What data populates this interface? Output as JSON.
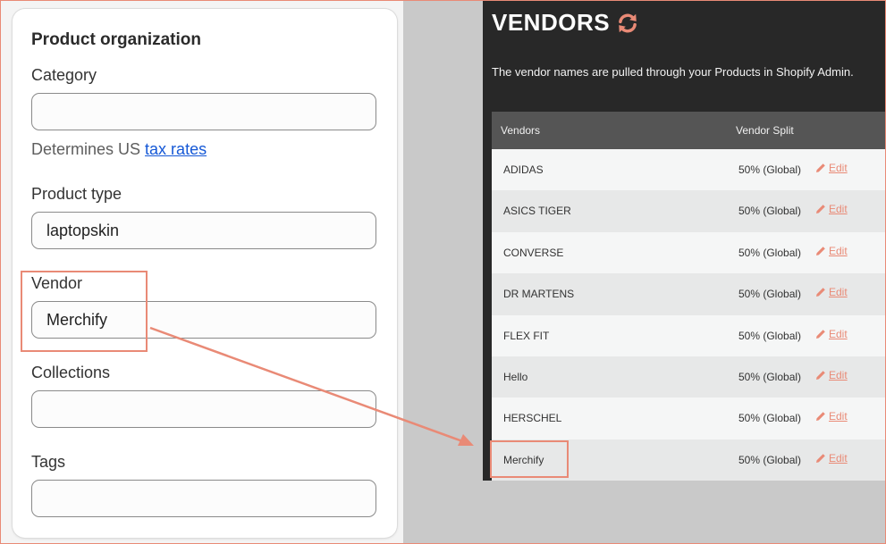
{
  "product_organization": {
    "title": "Product organization",
    "category": {
      "label": "Category",
      "value": ""
    },
    "help": {
      "prefix": "Determines US ",
      "link": "tax rates"
    },
    "product_type": {
      "label": "Product type",
      "value": "laptopskin"
    },
    "vendor": {
      "label": "Vendor",
      "value": "Merchify"
    },
    "collections": {
      "label": "Collections",
      "value": ""
    },
    "tags": {
      "label": "Tags",
      "value": ""
    }
  },
  "vendors_panel": {
    "title": "VENDORS",
    "icon": "refresh-icon",
    "description": "The vendor names are pulled through your Products in Shopify Admin.",
    "columns": [
      "Vendors",
      "Vendor Split"
    ],
    "edit_label": "Edit",
    "rows": [
      {
        "name": "ADIDAS",
        "split": "50% (Global)"
      },
      {
        "name": "ASICS TIGER",
        "split": "50% (Global)"
      },
      {
        "name": "CONVERSE",
        "split": "50% (Global)"
      },
      {
        "name": "DR MARTENS",
        "split": "50% (Global)"
      },
      {
        "name": "FLEX FIT",
        "split": "50% (Global)"
      },
      {
        "name": "Hello",
        "split": "50% (Global)"
      },
      {
        "name": "HERSCHEL",
        "split": "50% (Global)"
      },
      {
        "name": "Merchify",
        "split": "50% (Global)"
      }
    ]
  },
  "colors": {
    "accent": "#e98a76",
    "link": "#1558d6",
    "dark_panel": "#282828",
    "table_header": "#555555"
  }
}
